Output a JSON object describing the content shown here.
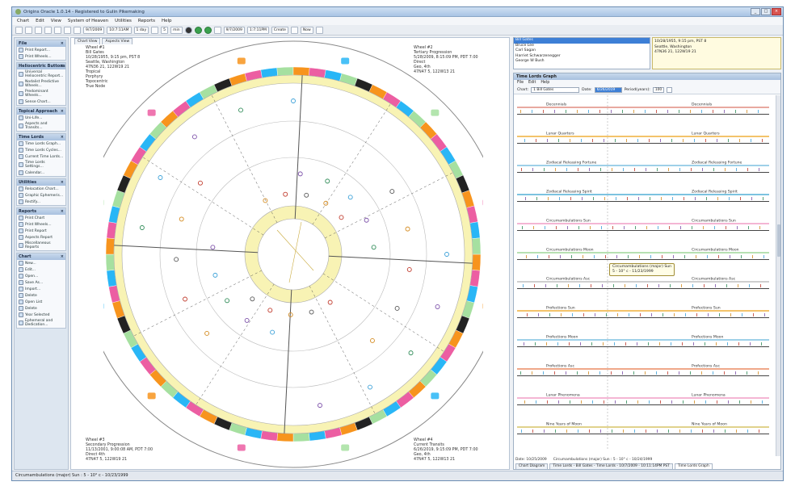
{
  "window": {
    "title": "Origins Oracle 1.0.14 - Registered to Gulin Pikemaking"
  },
  "menu": [
    "Chart",
    "Edit",
    "View",
    "System of Heaven",
    "Utilities",
    "Reports",
    "Help"
  ],
  "toolbar": {
    "date1": "9/7/2009",
    "time1": "10:7:11AM",
    "step": "1 day",
    "count": "5",
    "unit": "min",
    "date2": "9/7/2009",
    "time2": "1:7:11PM",
    "mode": "Create",
    "now_label": "Now"
  },
  "left_panel": {
    "sections": [
      {
        "title": "File",
        "items": [
          "Print Report...",
          "Print Wheels..."
        ]
      },
      {
        "title": "Heliocentric Buttons",
        "items": [
          "Universal Heliocentric Report...",
          "Nodalist Predictive Wheels...",
          "Predominant Wheels...",
          "Sense Chart..."
        ]
      },
      {
        "title": "Topical Approach",
        "items": [
          "Uni-Life...",
          "Aspects and Transits..."
        ]
      },
      {
        "title": "Time Lords",
        "items": [
          "Time Lords Graph...",
          "Time Lords Cycles...",
          "Current Time Lords...",
          "Time Lords Settings...",
          "Calendar..."
        ]
      },
      {
        "title": "Utilities",
        "items": [
          "Relocation Chart...",
          "Graphic Ephemeris...",
          "Rectify..."
        ]
      },
      {
        "title": "Reports",
        "items": [
          "Print Chart",
          "Print Wheels...",
          "Print Report",
          "Aspects Report",
          "Miscellaneous Reports"
        ]
      },
      {
        "title": "Chart",
        "items": [
          "New...",
          "Edit...",
          "Open...",
          "Save As...",
          "Import...",
          "Delete",
          "Open List",
          "Delete",
          "Year Selected",
          "Ephemeral and Dedication..."
        ]
      }
    ]
  },
  "chart_pane": {
    "tabs": [
      "Chart View",
      "Aspects View"
    ],
    "wheel1": "Wheel #1\nBill Gates\n10/28/1955, 9:15 pm, PST 8\nSeattle, Washington\n47N36 21, 122W19 21\nTropical\nPorphyry\nTopocentric\nTrue Node",
    "wheel2": "Wheel #2\nTertiary Progression\n5/28/2009, 8:15:09 PM, PDT 7:00\nDirect\nGeo, 4th\n47N47 5, 122W13 21",
    "wheel3": "Wheel #3\nSecondary Progression\n11/13/2001, 9:00:08 AM, PDT 7:00\nDirect 4th\n47N47 5, 122W19 21",
    "wheel4": "Wheel #4\nCurrent Transits\n6/26/2019, 9:15:09 PM, PDT 7:00\nGeo, 4th\n47N47 5, 122W13 21"
  },
  "people": {
    "list": [
      "Bill Gates",
      "Bruce Lee",
      "Carl Sagan",
      "Harriet Schwarzenegger",
      "George W Bush"
    ],
    "selected_index": 0,
    "info": "10/28/1955, 9:15 pm, PST 8\nSeattle, Washington\n47N36 21, 122W19 21"
  },
  "timelords": {
    "title": "Time Lords Graph",
    "menu": [
      "File",
      "Edit",
      "Help"
    ],
    "chart_label": "Chart:",
    "chart_value": "1 Bill Gates",
    "date_label": "Date:",
    "date_value": "6/26/2019",
    "periods_label": "Period(years):",
    "periods_value": "100",
    "rows": [
      {
        "left": "Decennials",
        "right": "Decennials",
        "color": "#e8a9a0"
      },
      {
        "left": "Lunar Quarters",
        "right": "Lunar Quarters",
        "color": "#f3c36b"
      },
      {
        "left": "Zodiacal Releasing Fortune",
        "right": "Zodiacal Releasing Fortune",
        "color": "#9ed0e8"
      },
      {
        "left": "Zodiacal Releasing Spirit",
        "right": "Zodiacal Releasing Spirit",
        "color": "#7cc3e0"
      },
      {
        "left": "Circumambulations Sun",
        "right": "Circumambulations Sun",
        "color": "#f4b6d4"
      },
      {
        "left": "Circumambulations Moon",
        "right": "Circumambulations Moon",
        "color": "#b7e0b2"
      },
      {
        "left": "Circumambulations Asc",
        "right": "Circumambulations Asc",
        "color": "#cfcfcf"
      },
      {
        "left": "Profections Sun",
        "right": "Profections Sun",
        "color": "#f3c36b"
      },
      {
        "left": "Profections Moon",
        "right": "Profections Moon",
        "color": "#9ed0e8"
      },
      {
        "left": "Profections Asc",
        "right": "Profections Asc",
        "color": "#f0a88a"
      },
      {
        "left": "Lunar Phenomena",
        "right": "Lunar Phenomena",
        "color": "#f4b6d4"
      },
      {
        "left": "Nine Years of Moon",
        "right": "Nine Years of Moon",
        "color": "#e0d28c"
      }
    ],
    "tooltip": "Circumambulations (major) Sun\n5 - 10° c - 11/23/1999",
    "status_date": "Date: 10/25/2009",
    "status_info": "Circumambulations (major) Sun : 5 - 10° c - 10/24/1999",
    "bottom_tabs": [
      "Chart Diagram",
      "Time Lords - Bill Gates - Time Lords - 10/7/2009 - 10:11:14PM PST",
      "Time Lords Graph"
    ]
  },
  "statusbar": "Circumambulations (major) Sun : 5 - 10° c - 10/23/1999",
  "colors": {
    "sign_ring": [
      "#f7941d",
      "#ec5ea2",
      "#29b6f6",
      "#a6e0a0",
      "#222222",
      "#f7941d",
      "#ec5ea2",
      "#29b6f6",
      "#a6e0a0"
    ],
    "house_ring": "#f8f3b4",
    "accent": "#3d7fd6"
  }
}
